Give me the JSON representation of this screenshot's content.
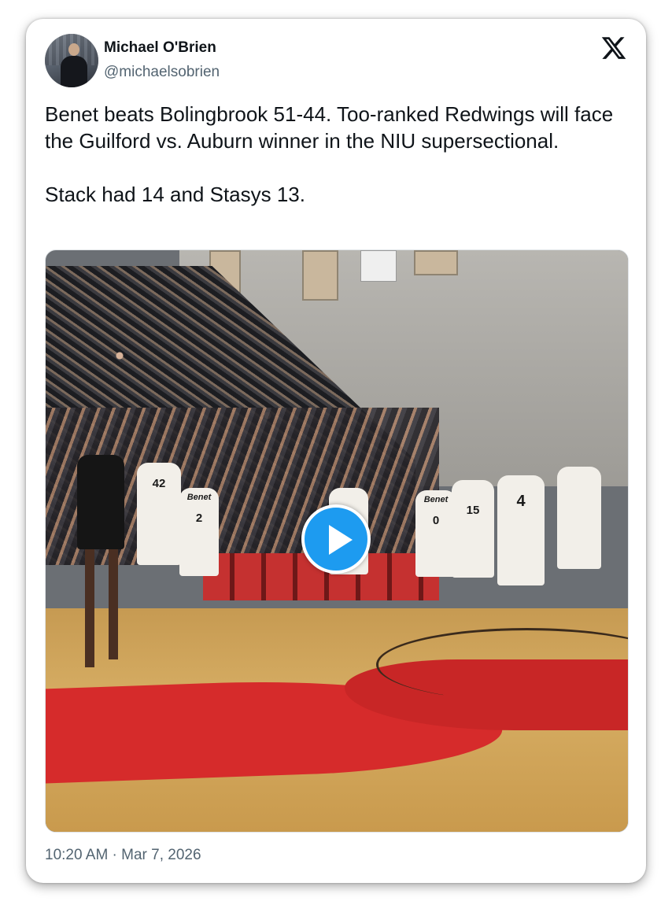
{
  "author": {
    "display_name": "Michael O'Brien",
    "handle": "@michaelsobrien"
  },
  "platform_icon": "x-logo-icon",
  "tweet": {
    "text": "Benet beats Bolingbrook 51-44. Too-ranked Redwings will face the Guilford vs. Auburn winner in the NIU supersectional.\n\nStack had 14 and Stasys 13."
  },
  "media": {
    "type": "video",
    "play_icon": "play-icon",
    "jersey_numbers": [
      "42",
      "2",
      "0",
      "15",
      "4"
    ],
    "jersey_text": [
      "Benet",
      "Benet"
    ]
  },
  "meta": {
    "timestamp": "10:20 AM · Mar 7, 2026"
  },
  "colors": {
    "accent": "#1d9bf0",
    "text": "#0f1419",
    "muted": "#536471"
  }
}
